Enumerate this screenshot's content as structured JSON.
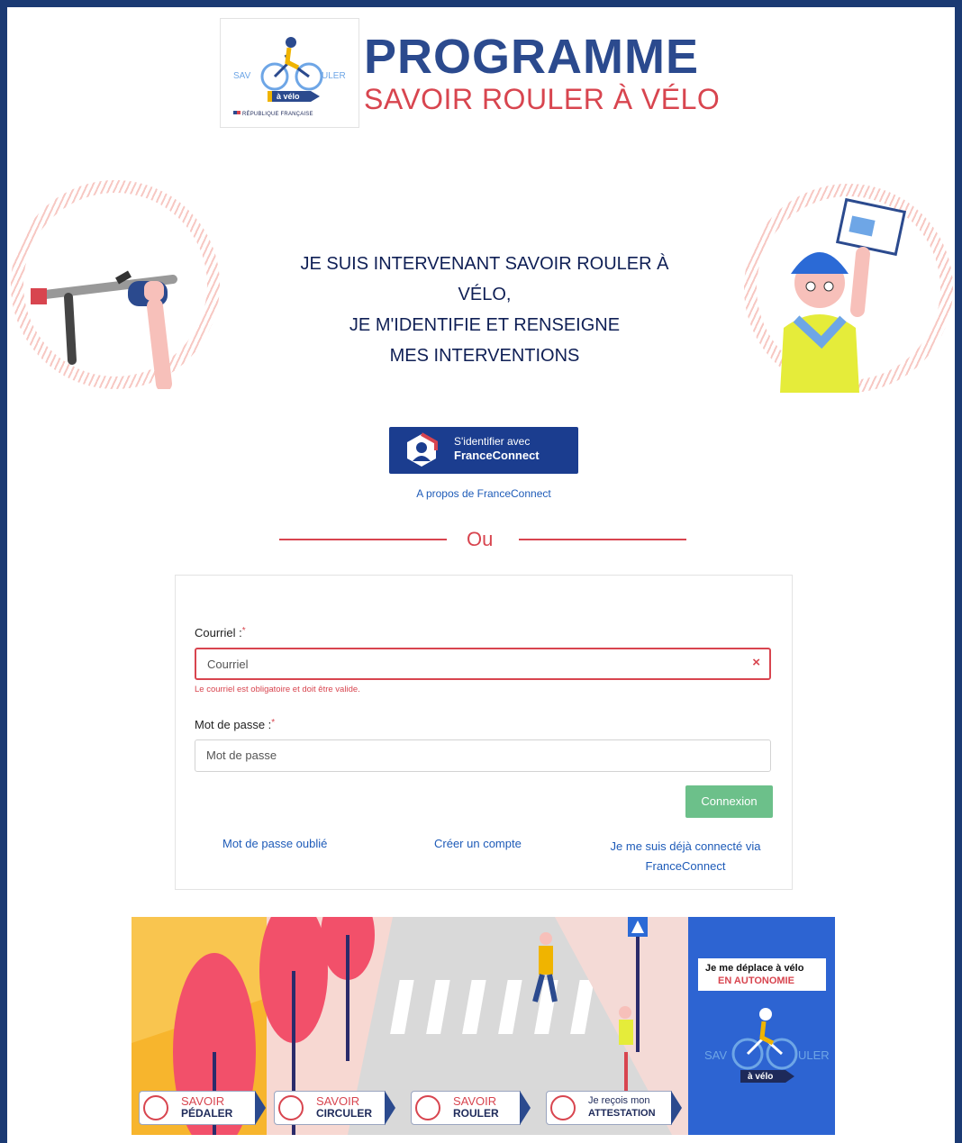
{
  "header": {
    "logo_small": {
      "line1": "SAV",
      "line2": "ULER",
      "badge": "à vélo",
      "footer": "RÉPUBLIQUE FRANÇAISE"
    },
    "title": "PROGRAMME",
    "subtitle": "SAVOIR ROULER À VÉLO"
  },
  "hero": {
    "lines": [
      "JE SUIS INTERVENANT SAVOIR ROULER À",
      "VÉLO,",
      "JE M'IDENTIFIE ET RENSEIGNE",
      "MES INTERVENTIONS"
    ]
  },
  "franceconnect": {
    "button_line1": "S'identifier avec",
    "button_line2": "FranceConnect",
    "about_link": "A propos de FranceConnect",
    "separator": "Ou"
  },
  "form": {
    "email_label": "Courriel :",
    "email_placeholder": "Courriel",
    "email_value": "",
    "email_error": "Le courriel est obligatoire et doit être valide.",
    "password_label": "Mot de passe :",
    "password_placeholder": "Mot de passe",
    "password_value": "",
    "required_mark": "*",
    "clear_symbol": "×",
    "submit_label": "Connexion",
    "link_forgot": "Mot de passe oublié",
    "link_create": "Créer un compte",
    "link_already_line1": "Je me suis déjà connecté via",
    "link_already_line2": "FranceConnect"
  },
  "banner": {
    "badges": [
      {
        "top": "SAVOIR",
        "bottom": "PÉDALER"
      },
      {
        "top": "SAVOIR",
        "bottom": "CIRCULER"
      },
      {
        "top": "SAVOIR",
        "bottom": "ROULER"
      },
      {
        "top": "Je reçois mon",
        "bottom": "ATTESTATION"
      }
    ],
    "autonomy_line1": "Je me déplace à vélo",
    "autonomy_line2": "EN AUTONOMIE",
    "panel_logo": {
      "left": "SAV",
      "right": "ULER",
      "badge": "à vélo"
    }
  },
  "colors": {
    "frame": "#1b3a73",
    "brand_blue": "#2b4a8e",
    "brand_red": "#d8454f",
    "success_green": "#6cc08a",
    "franceconnect_blue": "#1b3d8f",
    "link_blue": "#1e5bb8"
  }
}
